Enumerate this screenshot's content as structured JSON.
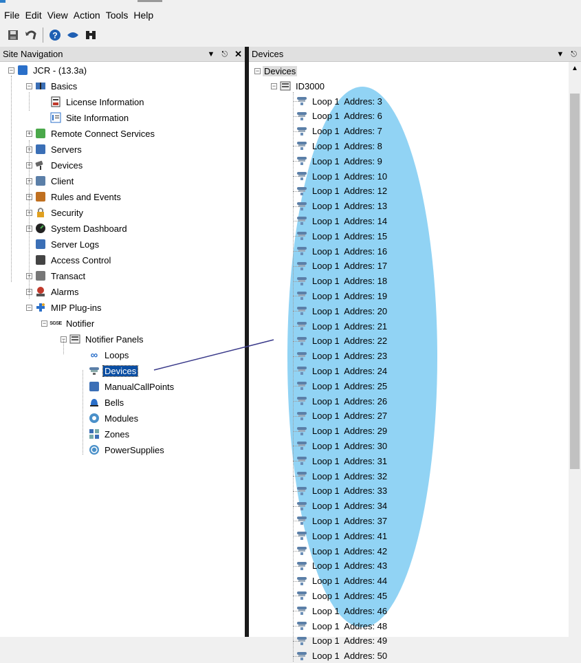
{
  "menubar": [
    "File",
    "Edit",
    "View",
    "Action",
    "Tools",
    "Help"
  ],
  "toolbar": {
    "icons": [
      "save-icon",
      "undo-icon",
      "help-icon",
      "collapse-icon",
      "binoculars-icon"
    ]
  },
  "left_pane": {
    "title": "Site Navigation",
    "tree": [
      {
        "label": "JCR - (13.3a)",
        "level": 0,
        "expander": "minus",
        "icon": "server-root-icon",
        "color": "#2a6fc9"
      },
      {
        "label": "Basics",
        "level": 1,
        "expander": "minus",
        "icon": "book-icon",
        "color": "#3b6fb6"
      },
      {
        "label": "License Information",
        "level": 2,
        "expander": "none",
        "icon": "license-icon",
        "color": "#c0392b"
      },
      {
        "label": "Site Information",
        "level": 2,
        "expander": "none",
        "icon": "site-info-icon",
        "color": "#2a6fc9"
      },
      {
        "label": "Remote Connect Services",
        "level": 1,
        "expander": "plus",
        "icon": "remote-connect-icon",
        "color": "#4aa84a"
      },
      {
        "label": "Servers",
        "level": 1,
        "expander": "plus",
        "icon": "servers-icon",
        "color": "#3b6fb6"
      },
      {
        "label": "Devices",
        "level": 1,
        "expander": "plus",
        "icon": "camera-icon",
        "color": "#666666"
      },
      {
        "label": "Client",
        "level": 1,
        "expander": "plus",
        "icon": "client-icon",
        "color": "#5b7fa8"
      },
      {
        "label": "Rules and Events",
        "level": 1,
        "expander": "plus",
        "icon": "rules-icon",
        "color": "#c07020"
      },
      {
        "label": "Security",
        "level": 1,
        "expander": "plus",
        "icon": "security-icon",
        "color": "#e0a020"
      },
      {
        "label": "System Dashboard",
        "level": 1,
        "expander": "plus",
        "icon": "dashboard-icon",
        "color": "#222222"
      },
      {
        "label": "Server Logs",
        "level": 1,
        "expander": "none",
        "icon": "logs-icon",
        "color": "#3b6fb6"
      },
      {
        "label": "Access Control",
        "level": 1,
        "expander": "none",
        "icon": "access-control-icon",
        "color": "#444444"
      },
      {
        "label": "Transact",
        "level": 1,
        "expander": "plus",
        "icon": "transact-icon",
        "color": "#777777"
      },
      {
        "label": "Alarms",
        "level": 1,
        "expander": "plus",
        "icon": "alarm-icon",
        "color": "#c0392b"
      },
      {
        "label": "MIP Plug-ins",
        "level": 1,
        "expander": "minus",
        "icon": "plugin-icon",
        "color": "#2a6fc9"
      },
      {
        "label": "Notifier",
        "level": 2,
        "expander": "minus",
        "icon": "sgse-icon",
        "color": "#333333"
      },
      {
        "label": "Notifier Panels",
        "level": 3,
        "expander": "minus",
        "icon": "panel-icon",
        "color": "#555555"
      },
      {
        "label": "Loops",
        "level": 4,
        "expander": "none",
        "icon": "loops-icon",
        "color": "#2a6fc9"
      },
      {
        "label": "Devices",
        "level": 4,
        "expander": "none",
        "icon": "detector-icon",
        "color": "#5b7fa8",
        "selected": true
      },
      {
        "label": "ManualCallPoints",
        "level": 4,
        "expander": "none",
        "icon": "callpoint-icon",
        "color": "#3b6fb6"
      },
      {
        "label": "Bells",
        "level": 4,
        "expander": "none",
        "icon": "bell-icon",
        "color": "#2a6fc9"
      },
      {
        "label": "Modules",
        "level": 4,
        "expander": "none",
        "icon": "module-icon",
        "color": "#4a90c9"
      },
      {
        "label": "Zones",
        "level": 4,
        "expander": "none",
        "icon": "zones-icon",
        "color": "#3b6fb6"
      },
      {
        "label": "PowerSupplies",
        "level": 4,
        "expander": "none",
        "icon": "power-icon",
        "color": "#4a90c9"
      }
    ]
  },
  "right_pane": {
    "title": "Devices",
    "root_label": "Devices",
    "panel_label": "ID3000",
    "devices": [
      "Loop 1  Addres: 3",
      "Loop 1  Addres: 6",
      "Loop 1  Addres: 7",
      "Loop 1  Addres: 8",
      "Loop 1  Addres: 9",
      "Loop 1  Addres: 10",
      "Loop 1  Addres: 12",
      "Loop 1  Addres: 13",
      "Loop 1  Addres: 14",
      "Loop 1  Addres: 15",
      "Loop 1  Addres: 16",
      "Loop 1  Addres: 17",
      "Loop 1  Addres: 18",
      "Loop 1  Addres: 19",
      "Loop 1  Addres: 20",
      "Loop 1  Addres: 21",
      "Loop 1  Addres: 22",
      "Loop 1  Addres: 23",
      "Loop 1  Addres: 24",
      "Loop 1  Addres: 25",
      "Loop 1  Addres: 26",
      "Loop 1  Addres: 27",
      "Loop 1  Addres: 29",
      "Loop 1  Addres: 30",
      "Loop 1  Addres: 31",
      "Loop 1  Addres: 32",
      "Loop 1  Addres: 33",
      "Loop 1  Addres: 34",
      "Loop 1  Addres: 37",
      "Loop 1  Addres: 41",
      "Loop 1  Addres: 42",
      "Loop 1  Addres: 43",
      "Loop 1  Addres: 44",
      "Loop 1  Addres: 45",
      "Loop 1  Addres: 46",
      "Loop 1  Addres: 48",
      "Loop 1  Addres: 49",
      "Loop 1  Addres: 50"
    ]
  },
  "colors": {
    "selection": "#0a4ea3",
    "highlight_ellipse": "#7ecbf2",
    "connector_line": "#3a3a8a"
  }
}
